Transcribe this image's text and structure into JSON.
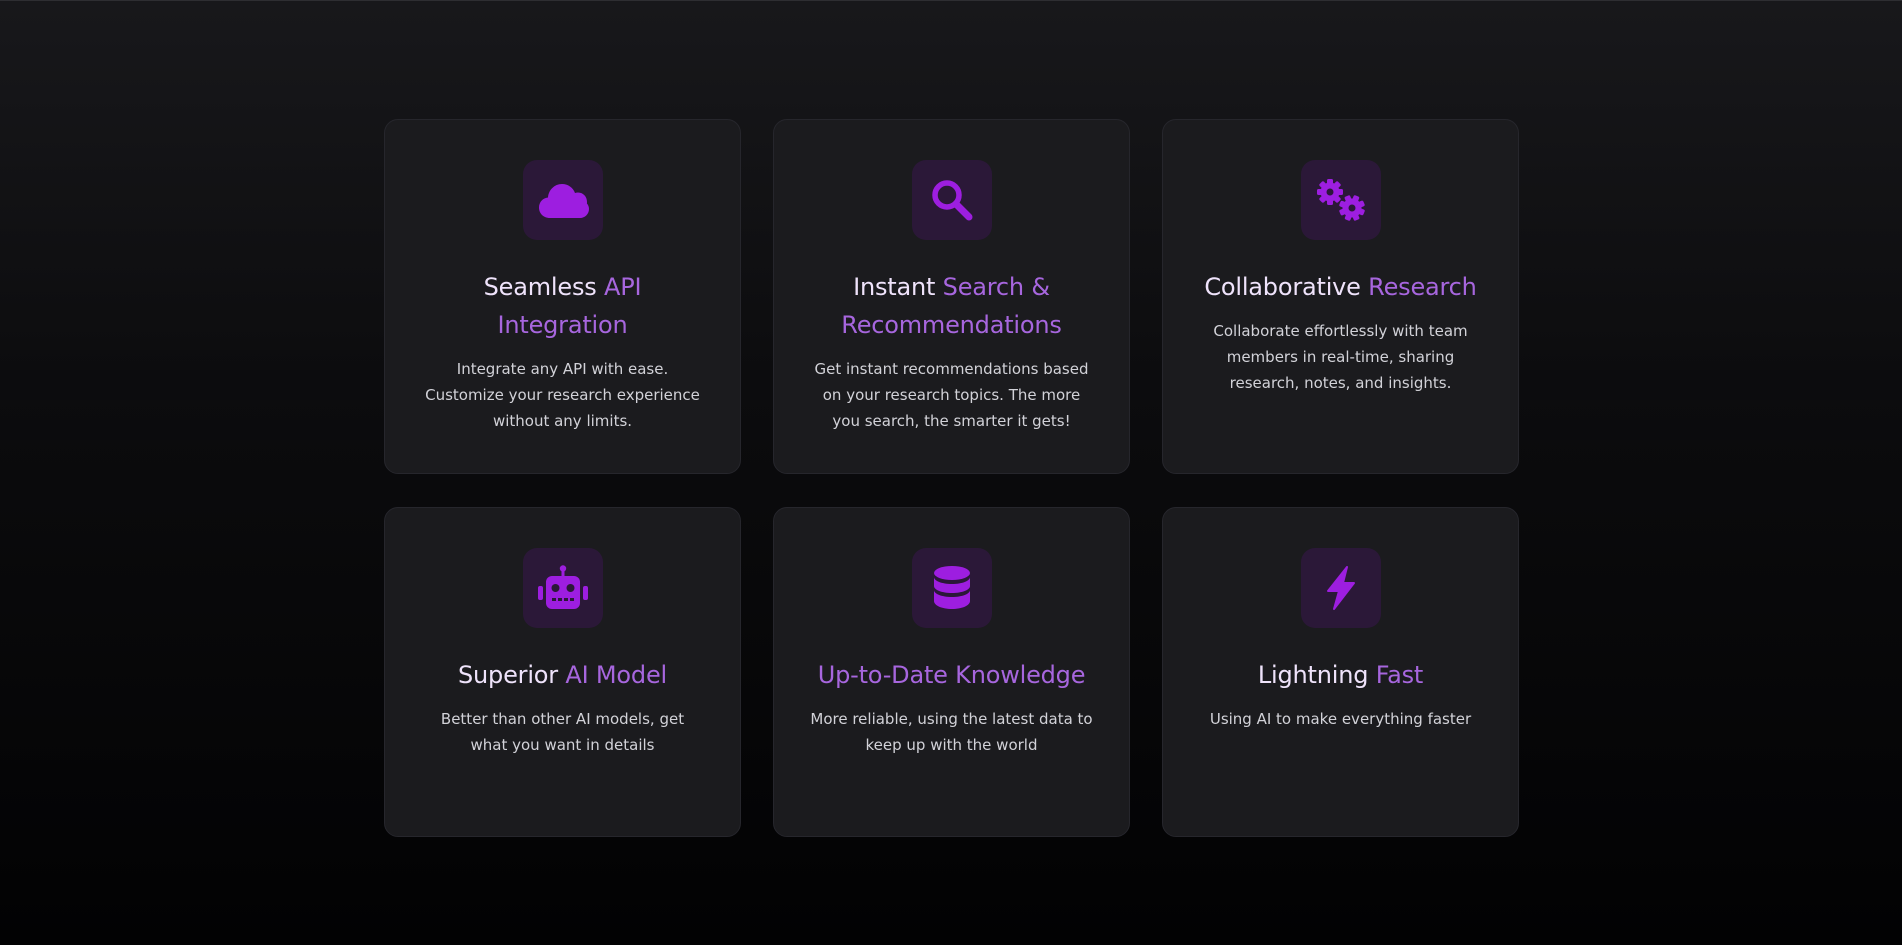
{
  "colors": {
    "accent": "#9d1ee0",
    "title_light": "#efe3fb",
    "title_accent": "#a766de",
    "card_bg": "#1b1b1e",
    "icon_bg": "#2b1838"
  },
  "features": [
    {
      "icon": "cloud-icon",
      "title_part1": "Seamless ",
      "title_part2": "API Integration",
      "description": "Integrate any API with ease. Customize your research experience without any limits."
    },
    {
      "icon": "search-icon",
      "title_part1": "Instant ",
      "title_part2": "Search & Recommendations",
      "description": "Get instant recommendations based on your research topics. The more you search, the smarter it gets!"
    },
    {
      "icon": "gears-icon",
      "title_part1": "Collaborative ",
      "title_part2": "Research",
      "description": "Collaborate effortlessly with team members in real-time, sharing research, notes, and insights."
    },
    {
      "icon": "robot-icon",
      "title_part1": "Superior ",
      "title_part2": "AI Model",
      "description": "Better than other AI models, get what you want in details"
    },
    {
      "icon": "database-icon",
      "title_part1": "Up-to-Date ",
      "title_part2": "Knowledge",
      "description": "More reliable, using the latest data to keep up with the world"
    },
    {
      "icon": "lightning-icon",
      "title_part1": "Lightning ",
      "title_part2": "Fast",
      "description": "Using AI to make everything faster"
    }
  ]
}
